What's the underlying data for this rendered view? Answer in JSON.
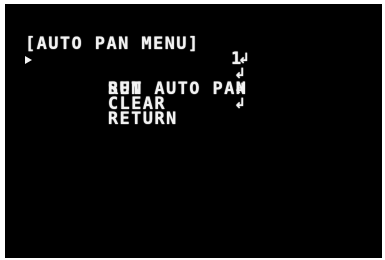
{
  "menu": {
    "title": "[AUTO PAN MENU]",
    "cursor_icon": "right-triangle-cursor",
    "enter_icon_glyph": "↲",
    "items": [
      {
        "label": "SET AUTO PAN",
        "value": "1",
        "selected": true
      },
      {
        "label": "RUN",
        "value": "",
        "selected": false
      },
      {
        "label": "CLEAR",
        "value": "",
        "selected": false
      },
      {
        "label": "RETURN",
        "value": "",
        "selected": false
      }
    ]
  },
  "colors": {
    "background": "#000000",
    "text": "#f2f2f2"
  }
}
